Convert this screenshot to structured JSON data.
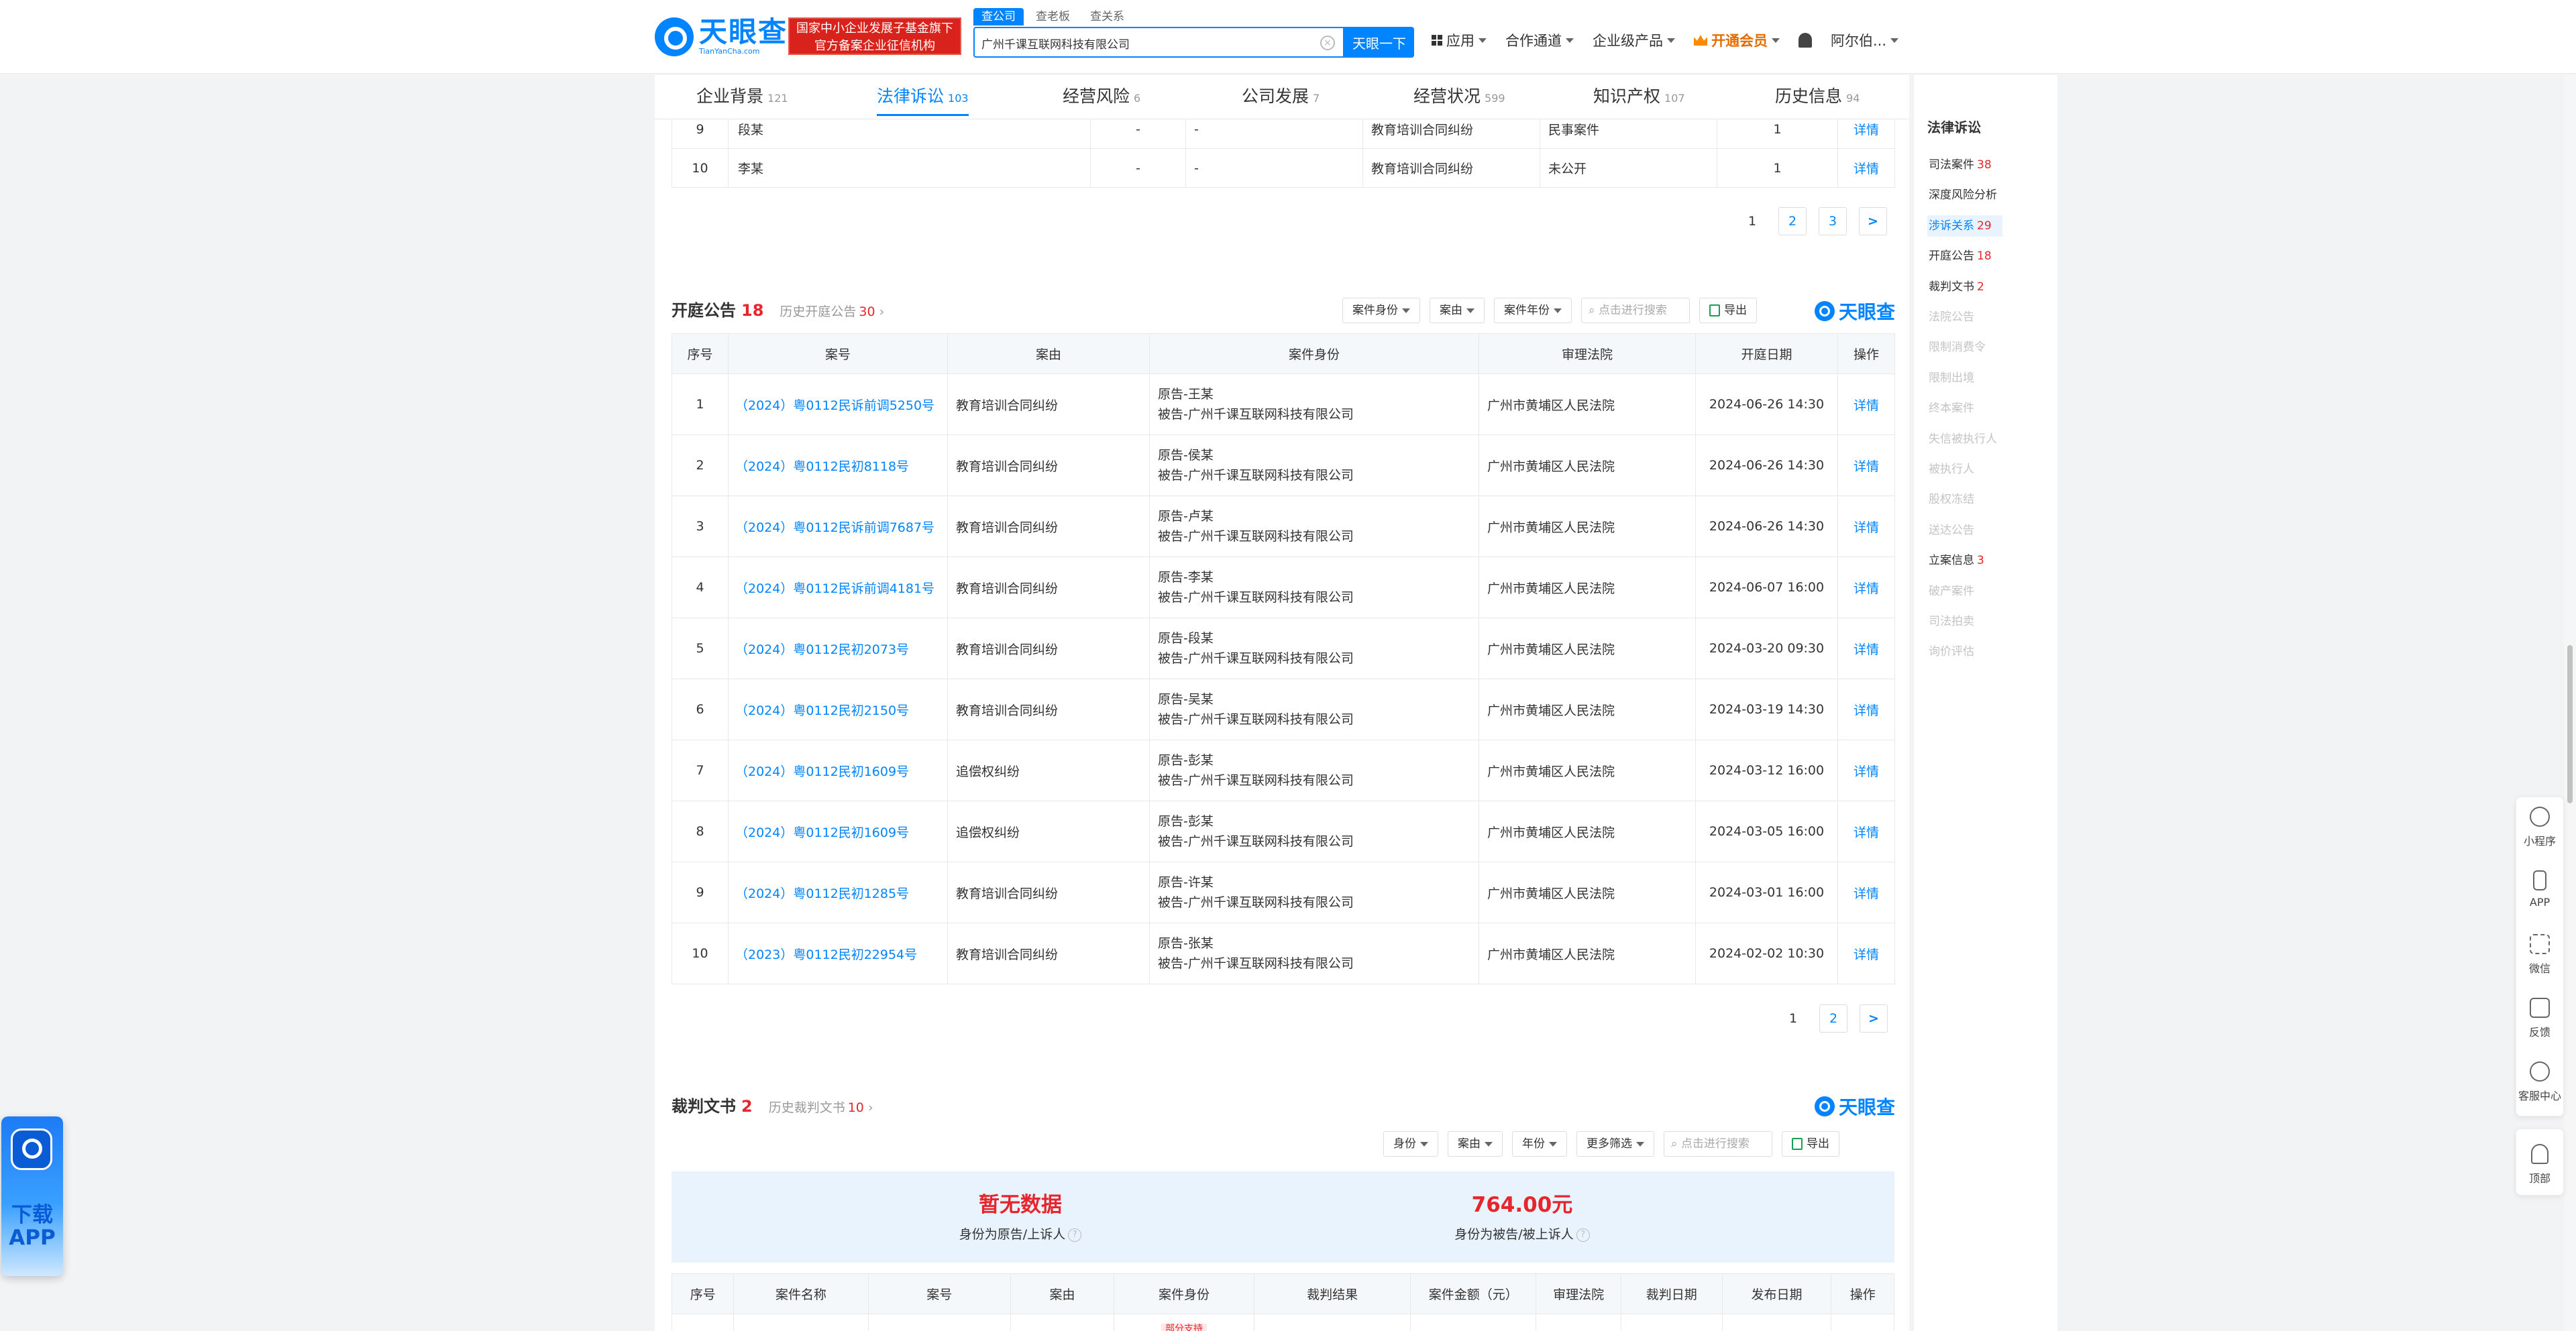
{
  "header": {
    "logo_name": "天眼查",
    "logo_sub": "TianYanCha.com",
    "badge_line1": "国家中小企业发展子基金旗下",
    "badge_line2": "官方备案企业征信机构",
    "search_tabs": [
      "查公司",
      "查老板",
      "查关系"
    ],
    "search_value": "广州千课互联网科技有限公司",
    "search_button": "天眼一下",
    "nav": [
      "应用",
      "合作通道",
      "企业级产品",
      "开通会员",
      "阿尔伯..."
    ]
  },
  "main_tabs": [
    {
      "label": "企业背景",
      "count": "121"
    },
    {
      "label": "法律诉讼",
      "count": "103"
    },
    {
      "label": "经营风险",
      "count": "6"
    },
    {
      "label": "公司发展",
      "count": "7"
    },
    {
      "label": "经营状况",
      "count": "599"
    },
    {
      "label": "知识产权",
      "count": "107"
    },
    {
      "label": "历史信息",
      "count": "94"
    }
  ],
  "prev_table": {
    "rows": [
      {
        "no": "9",
        "name": "段某",
        "c3": "-",
        "c4": "-",
        "cause": "教育培训合同纠纷",
        "type": "民事案件",
        "count": "1",
        "action": "详情"
      },
      {
        "no": "10",
        "name": "李某",
        "c3": "-",
        "c4": "-",
        "cause": "教育培训合同纠纷",
        "type": "未公开",
        "count": "1",
        "action": "详情"
      }
    ],
    "pages": [
      "1",
      "2",
      "3",
      ">"
    ]
  },
  "hearing": {
    "title": "开庭公告",
    "count": "18",
    "history_label": "历史开庭公告",
    "history_count": "30",
    "filters": [
      "案件身份",
      "案由",
      "案件年份"
    ],
    "search_placeholder": "点击进行搜索",
    "export": "导出",
    "watermark": "天眼查",
    "columns": [
      "序号",
      "案号",
      "案由",
      "案件身份",
      "审理法院",
      "开庭日期",
      "操作"
    ],
    "rows": [
      {
        "no": "1",
        "case": "（2024）粤0112民诉前调5250号",
        "cause": "教育培训合同纠纷",
        "party1": "原告-王某",
        "party2": "被告-广州千课互联网科技有限公司",
        "court": "广州市黄埔区人民法院",
        "date": "2024-06-26 14:30",
        "action": "详情"
      },
      {
        "no": "2",
        "case": "（2024）粤0112民初8118号",
        "cause": "教育培训合同纠纷",
        "party1": "原告-侯某",
        "party2": "被告-广州千课互联网科技有限公司",
        "court": "广州市黄埔区人民法院",
        "date": "2024-06-26 14:30",
        "action": "详情"
      },
      {
        "no": "3",
        "case": "（2024）粤0112民诉前调7687号",
        "cause": "教育培训合同纠纷",
        "party1": "原告-卢某",
        "party2": "被告-广州千课互联网科技有限公司",
        "court": "广州市黄埔区人民法院",
        "date": "2024-06-26 14:30",
        "action": "详情"
      },
      {
        "no": "4",
        "case": "（2024）粤0112民诉前调4181号",
        "cause": "教育培训合同纠纷",
        "party1": "原告-李某",
        "party2": "被告-广州千课互联网科技有限公司",
        "court": "广州市黄埔区人民法院",
        "date": "2024-06-07 16:00",
        "action": "详情"
      },
      {
        "no": "5",
        "case": "（2024）粤0112民初2073号",
        "cause": "教育培训合同纠纷",
        "party1": "原告-段某",
        "party2": "被告-广州千课互联网科技有限公司",
        "court": "广州市黄埔区人民法院",
        "date": "2024-03-20 09:30",
        "action": "详情"
      },
      {
        "no": "6",
        "case": "（2024）粤0112民初2150号",
        "cause": "教育培训合同纠纷",
        "party1": "原告-吴某",
        "party2": "被告-广州千课互联网科技有限公司",
        "court": "广州市黄埔区人民法院",
        "date": "2024-03-19 14:30",
        "action": "详情"
      },
      {
        "no": "7",
        "case": "（2024）粤0112民初1609号",
        "cause": "追偿权纠纷",
        "party1": "原告-彭某",
        "party2": "被告-广州千课互联网科技有限公司",
        "court": "广州市黄埔区人民法院",
        "date": "2024-03-12 16:00",
        "action": "详情"
      },
      {
        "no": "8",
        "case": "（2024）粤0112民初1609号",
        "cause": "追偿权纠纷",
        "party1": "原告-彭某",
        "party2": "被告-广州千课互联网科技有限公司",
        "court": "广州市黄埔区人民法院",
        "date": "2024-03-05 16:00",
        "action": "详情"
      },
      {
        "no": "9",
        "case": "（2024）粤0112民初1285号",
        "cause": "教育培训合同纠纷",
        "party1": "原告-许某",
        "party2": "被告-广州千课互联网科技有限公司",
        "court": "广州市黄埔区人民法院",
        "date": "2024-03-01 16:00",
        "action": "详情"
      },
      {
        "no": "10",
        "case": "（2023）粤0112民初22954号",
        "cause": "教育培训合同纠纷",
        "party1": "原告-张某",
        "party2": "被告-广州千课互联网科技有限公司",
        "court": "广州市黄埔区人民法院",
        "date": "2024-02-02 10:30",
        "action": "详情"
      }
    ],
    "pages": [
      "1",
      "2",
      ">"
    ]
  },
  "judgment": {
    "title": "裁判文书",
    "count": "2",
    "history_label": "历史裁判文书",
    "history_count": "10",
    "filters": [
      "身份",
      "案由",
      "年份",
      "更多筛选"
    ],
    "search_placeholder": "点击进行搜索",
    "export": "导出",
    "watermark": "天眼查",
    "stat_left_value": "暂无数据",
    "stat_left_label": "身份为原告/上诉人",
    "stat_right_value": "764.00元",
    "stat_right_label": "身份为被告/被上诉人",
    "columns": [
      "序号",
      "案件名称",
      "案号",
      "案由",
      "案件身份",
      "裁判结果",
      "案件金额（元）",
      "审理法院",
      "裁判日期",
      "发布日期",
      "操作"
    ],
    "partial_tag": "部分支持"
  },
  "sidebar": {
    "title": "法律诉讼",
    "items": [
      {
        "label": "司法案件",
        "count": "38",
        "state": "normal"
      },
      {
        "label": "深度风险分析",
        "count": "",
        "state": "normal"
      },
      {
        "label": "涉诉关系",
        "count": "29",
        "state": "active"
      },
      {
        "label": "开庭公告",
        "count": "18",
        "state": "normal"
      },
      {
        "label": "裁判文书",
        "count": "2",
        "state": "normal"
      },
      {
        "label": "法院公告",
        "count": "",
        "state": "dim"
      },
      {
        "label": "限制消费令",
        "count": "",
        "state": "dim"
      },
      {
        "label": "限制出境",
        "count": "",
        "state": "dim"
      },
      {
        "label": "终本案件",
        "count": "",
        "state": "dim"
      },
      {
        "label": "失信被执行人",
        "count": "",
        "state": "dim"
      },
      {
        "label": "被执行人",
        "count": "",
        "state": "dim"
      },
      {
        "label": "股权冻结",
        "count": "",
        "state": "dim"
      },
      {
        "label": "送达公告",
        "count": "",
        "state": "dim"
      },
      {
        "label": "立案信息",
        "count": "3",
        "state": "normal"
      },
      {
        "label": "破产案件",
        "count": "",
        "state": "dim"
      },
      {
        "label": "司法拍卖",
        "count": "",
        "state": "dim"
      },
      {
        "label": "询价评估",
        "count": "",
        "state": "dim"
      }
    ]
  },
  "float_tools": [
    "小程序",
    "APP",
    "微信",
    "反馈",
    "客服中心",
    "顶部"
  ],
  "download_app": "下载APP",
  "colors": {
    "brand": "#0084ff",
    "danger": "#e6262c",
    "badge": "#d8231d"
  }
}
